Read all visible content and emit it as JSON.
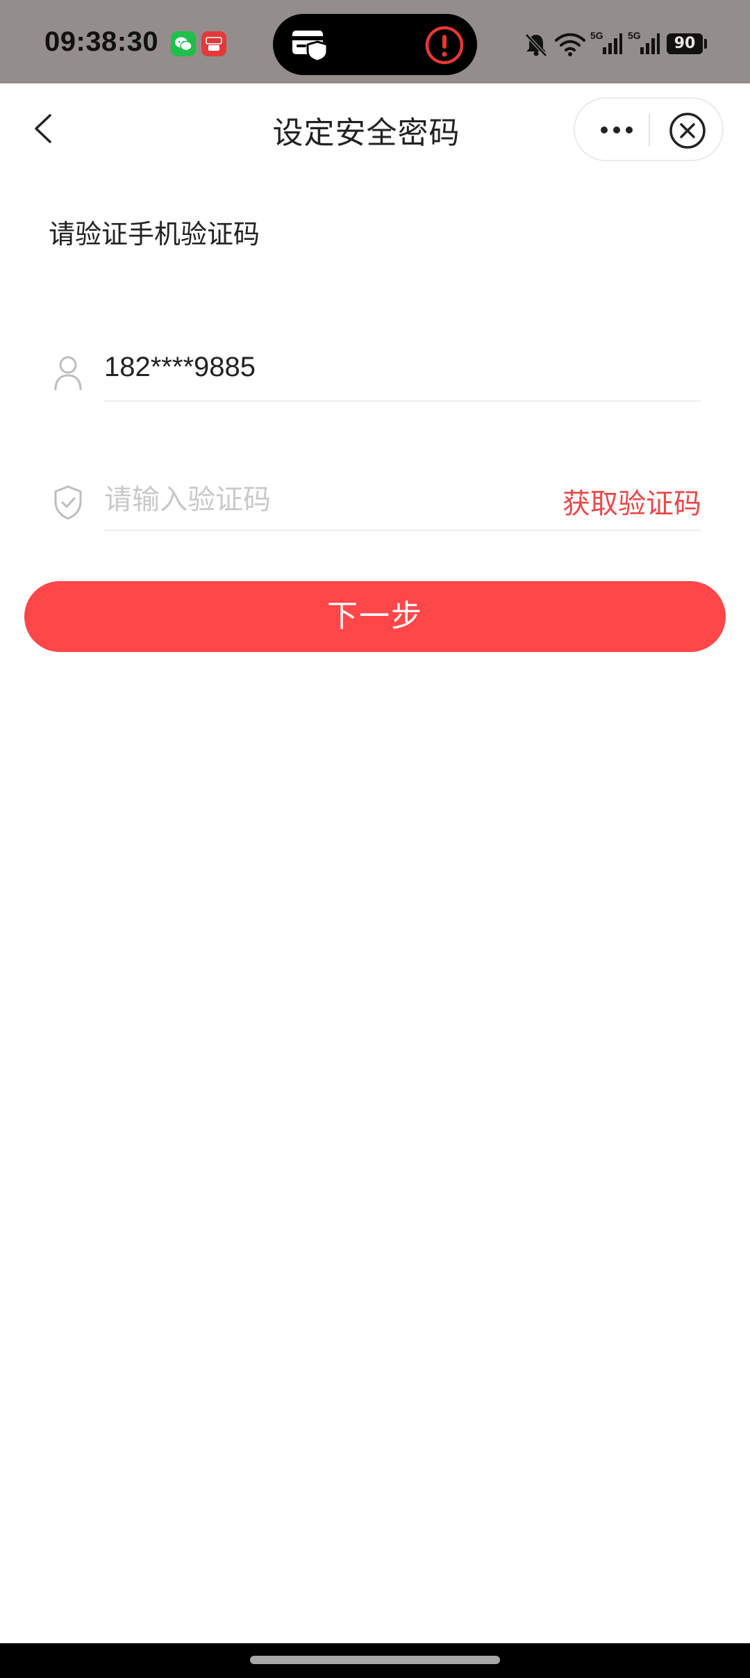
{
  "status_bar": {
    "time": "09:38:30",
    "notification_icons": [
      "wechat-icon",
      "wallet-pay-icon"
    ],
    "island_icons": [
      "card-shield-icon",
      "alert-icon"
    ],
    "network_1": "5G",
    "network_2": "5G",
    "battery": "90",
    "colors": {
      "background": "#938e8b",
      "alert": "#e53935"
    }
  },
  "nav": {
    "title": "设定安全密码"
  },
  "form": {
    "subtitle": "请验证手机验证码",
    "phone": "182****9885",
    "code_placeholder": "请输入验证码",
    "code_value": "",
    "get_code_label": "获取验证码"
  },
  "actions": {
    "next_label": "下一步"
  },
  "colors": {
    "accent": "#ff4649",
    "link": "#e8484a"
  }
}
